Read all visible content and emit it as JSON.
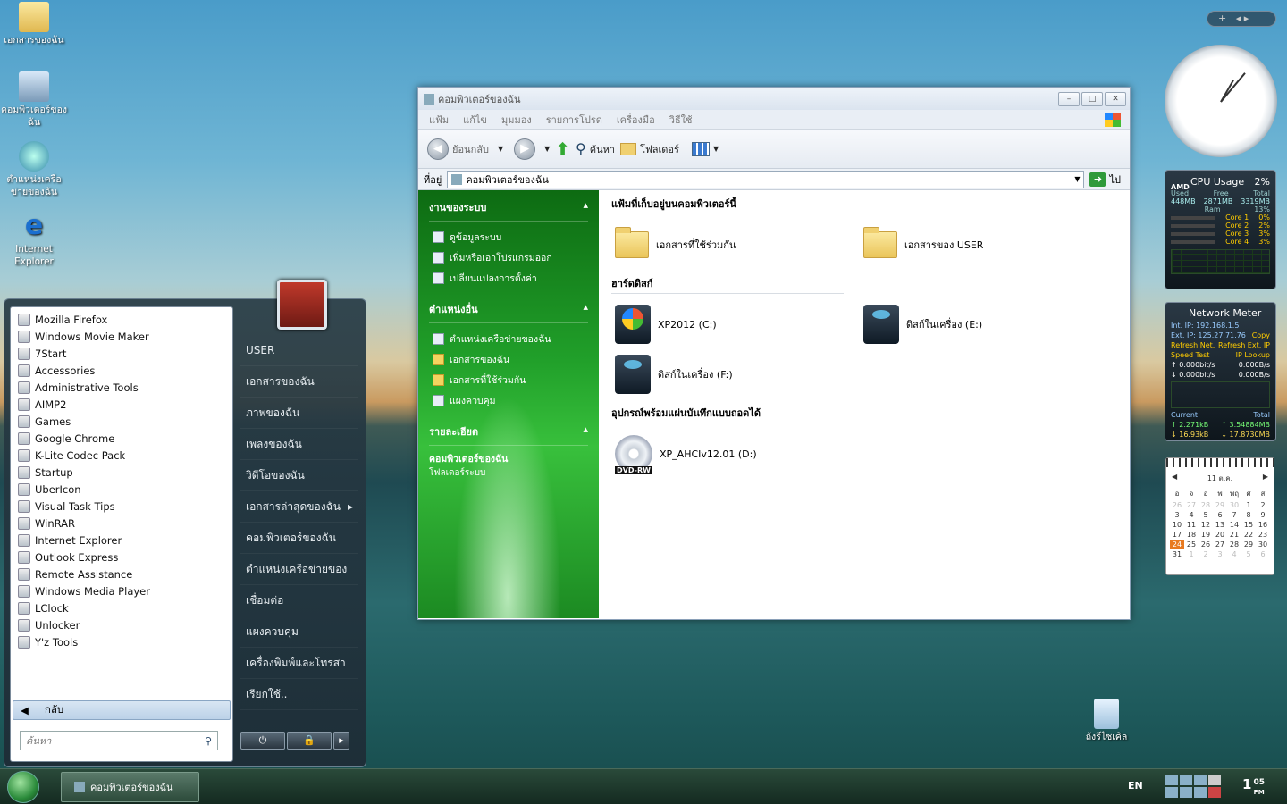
{
  "desktop": {
    "icons": [
      {
        "label": "เอกสารของฉัน"
      },
      {
        "label": "คอมพิวเตอร์ของฉัน"
      },
      {
        "label": "ตำแหน่งเครือข่ายของฉัน"
      },
      {
        "label": "Internet Explorer"
      },
      {
        "label": "ถังรีไซเคิล"
      }
    ]
  },
  "window": {
    "title": "คอมพิวเตอร์ของฉัน",
    "menu": [
      "แฟ้ม",
      "แก้ไข",
      "มุมมอง",
      "รายการโปรด",
      "เครื่องมือ",
      "วิธีใช้"
    ],
    "toolbar": {
      "back": "ย้อนกลับ",
      "search": "ค้นหา",
      "folders": "โฟลเดอร์"
    },
    "address": {
      "label": "ที่อยู่",
      "value": "คอมพิวเตอร์ของฉัน",
      "go": "ไป"
    },
    "taskpane": {
      "system": {
        "title": "งานของระบบ",
        "links": [
          "ดูข้อมูลระบบ",
          "เพิ่มหรือเอาโปรแกรมออก",
          "เปลี่ยนแปลงการตั้งค่า"
        ]
      },
      "places": {
        "title": "ตำแหน่งอื่น",
        "links": [
          "ตำแหน่งเครือข่ายของฉัน",
          "เอกสารของฉัน",
          "เอกสารที่ใช้ร่วมกัน",
          "แผงควบคุม"
        ]
      },
      "details": {
        "title": "รายละเอียด",
        "name": "คอมพิวเตอร์ของฉัน",
        "type": "โฟลเดอร์ระบบ"
      }
    },
    "groups": {
      "files_title": "แฟ้มที่เก็บอยู่บนคอมพิวเตอร์นี้",
      "files": [
        "เอกสารที่ใช้ร่วมกัน",
        "เอกสารของ USER"
      ],
      "drives_title": "ฮาร์ดดิสก์",
      "drives": [
        "XP2012 (C:)",
        "ดิสก์ในเครื่อง (E:)",
        "ดิสก์ในเครื่อง (F:)"
      ],
      "removable_title": "อุปกรณ์พร้อมแผ่นบันทึกแบบถอดได้",
      "removable": [
        "XP_AHCIv12.01 (D:)"
      ],
      "dvd_badge": "DVD-RW"
    }
  },
  "startmenu": {
    "programs": [
      "Mozilla Firefox",
      "Windows Movie Maker",
      "7Start",
      "Accessories",
      "Administrative Tools",
      "AIMP2",
      "Games",
      "Google Chrome",
      "K-Lite Codec Pack",
      "Startup",
      "UberIcon",
      "Visual Task Tips",
      "WinRAR",
      "Internet Explorer",
      "Outlook Express",
      "Remote Assistance",
      "Windows Media Player",
      "LClock",
      "Unlocker",
      "Y'z Tools"
    ],
    "back": "กลับ",
    "search_placeholder": "ค้นหา",
    "right": [
      "USER",
      "เอกสารของฉัน",
      "ภาพของฉัน",
      "เพลงของฉัน",
      "วิดีโอของฉัน",
      "เอกสารล่าสุดของฉัน",
      "คอมพิวเตอร์ของฉัน",
      "ตำแหน่งเครือข่ายของ",
      "เชื่อมต่อ",
      "แผงควบคุม",
      "เครื่องพิมพ์และโทรสา",
      "เรียกใช้.."
    ]
  },
  "taskbar": {
    "task": "คอมพิวเตอร์ของฉัน",
    "lang": "EN",
    "time": "1",
    "time_min": "05",
    "ampm": "PM"
  },
  "gadgets": {
    "cpu": {
      "title": "CPU Usage",
      "pct": "2%",
      "brand": "AMD",
      "used_l": "Used",
      "free_l": "Free",
      "total_l": "Total",
      "used": "448MB",
      "free": "2871MB",
      "total": "3319MB",
      "ram": "Ram",
      "ram_pct": "13%",
      "cores": [
        [
          "Core 1",
          "0%"
        ],
        [
          "Core 2",
          "2%"
        ],
        [
          "Core 3",
          "3%"
        ],
        [
          "Core 4",
          "3%"
        ]
      ]
    },
    "net": {
      "title": "Network Meter",
      "int": "Int. IP: 192.168.1.5",
      "ext": "Ext. IP: 125.27.71.76",
      "copy": "Copy",
      "refresh": "Refresh Net.",
      "refresh_ext": "Refresh Ext. IP",
      "speed": "Speed Test",
      "lookup": "IP Lookup",
      "up1": "0.000bit/s",
      "up2": "0.000B/s",
      "dn1": "0.000bit/s",
      "dn2": "0.000B/s",
      "current": "Current",
      "total": "Total",
      "cu": "2.271kB",
      "cd": "16.93kB",
      "tu": "3.54884MB",
      "td": "17.8730MB"
    },
    "calendar": {
      "month": "11 ต.ค.",
      "days": [
        "อ",
        "จ",
        "อ",
        "พ",
        "พฤ",
        "ศ",
        "ส"
      ]
    }
  }
}
